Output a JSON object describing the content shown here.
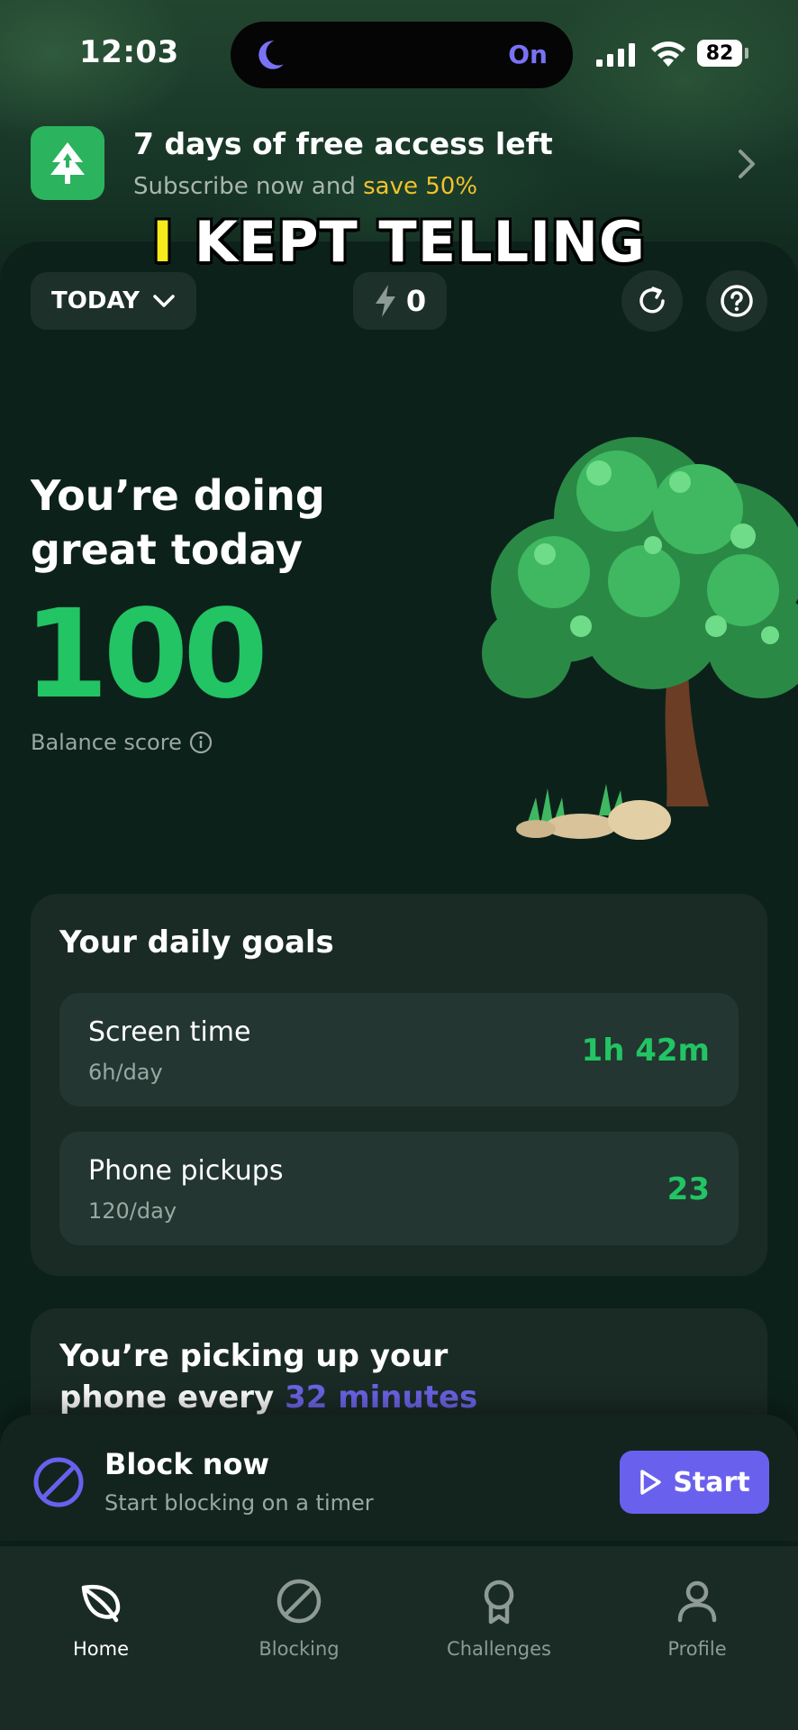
{
  "status_bar": {
    "time": "12:03",
    "focus": "On",
    "battery": "82"
  },
  "promo": {
    "title": "7 days of free access left",
    "subtitle_prefix": "Subscribe now and ",
    "subtitle_highlight": "save 50%"
  },
  "caption": {
    "highlight": "I",
    "text": " KEPT TELLING"
  },
  "header": {
    "period": "TODAY",
    "streak": "0"
  },
  "hero": {
    "title_line1": "You’re doing",
    "title_line2": "great today",
    "score": "100",
    "score_label": "Balance score"
  },
  "goals": {
    "title": "Your daily goals",
    "items": [
      {
        "name": "Screen time",
        "target": "6h/day",
        "value": "1h 42m"
      },
      {
        "name": "Phone pickups",
        "target": "120/day",
        "value": "23"
      }
    ]
  },
  "pickups": {
    "line1": "You’re picking up your",
    "line2_prefix": "phone every ",
    "line2_highlight": "32 minutes"
  },
  "block": {
    "title": "Block now",
    "subtitle": "Start blocking on a timer",
    "button": "Start"
  },
  "tabs": [
    {
      "label": "Home",
      "icon": "leaf-icon",
      "active": true
    },
    {
      "label": "Blocking",
      "icon": "block-icon",
      "active": false
    },
    {
      "label": "Challenges",
      "icon": "award-icon",
      "active": false
    },
    {
      "label": "Profile",
      "icon": "person-icon",
      "active": false
    }
  ],
  "colors": {
    "accent_green": "#22c464",
    "accent_purple": "#6a60ee",
    "highlight_yellow": "#f2c22a"
  }
}
